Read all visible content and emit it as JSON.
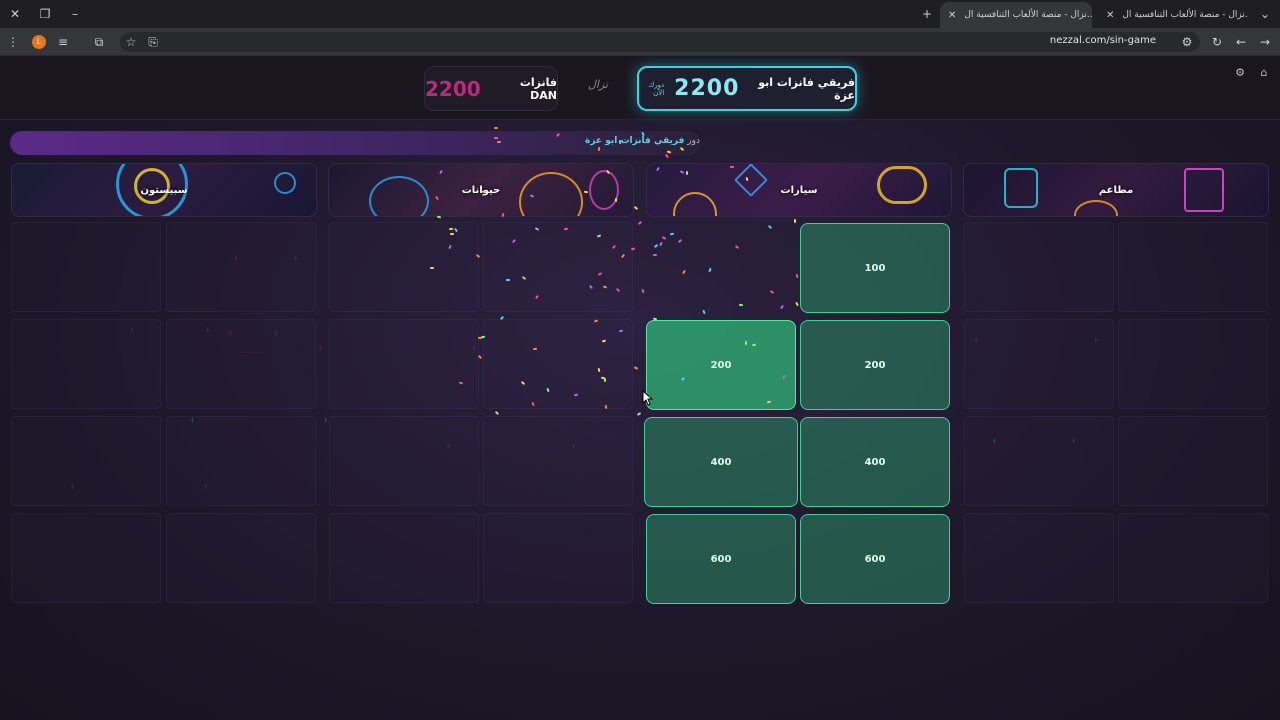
{
  "browser": {
    "tabs": [
      {
        "title": "نزال - منصة الألعاب التنافسية ال...",
        "active": true
      },
      {
        "title": "نزال - منصة الألعاب التنافسية ال...",
        "active": false
      }
    ],
    "url": "nezzal.com/sin-game",
    "profile_initial": "L"
  },
  "scoreboard": {
    "team_a": {
      "name": "فريقي فانزات ابو عزة",
      "score": "2200",
      "turn_tag": "دورك الآن"
    },
    "team_b": {
      "name": "فانزات DAN",
      "score": "2200"
    },
    "logo_text": "نزال"
  },
  "turn": {
    "prefix": "دور",
    "team": "فريقي فانزات ابو عزة"
  },
  "categories": [
    {
      "label": "مطاعم"
    },
    {
      "label": "سيارات"
    },
    {
      "label": "حيوانات"
    },
    {
      "label": "سبيستون"
    }
  ],
  "tiles": [
    {
      "label": "100"
    },
    {
      "label": "200"
    },
    {
      "label": "200"
    },
    {
      "label": "400"
    },
    {
      "label": "400"
    },
    {
      "label": "600"
    },
    {
      "label": "600"
    }
  ],
  "colors": {
    "accent": "#34d6e6",
    "tile": "#3fd198",
    "team_b_score": "#c0287f"
  }
}
